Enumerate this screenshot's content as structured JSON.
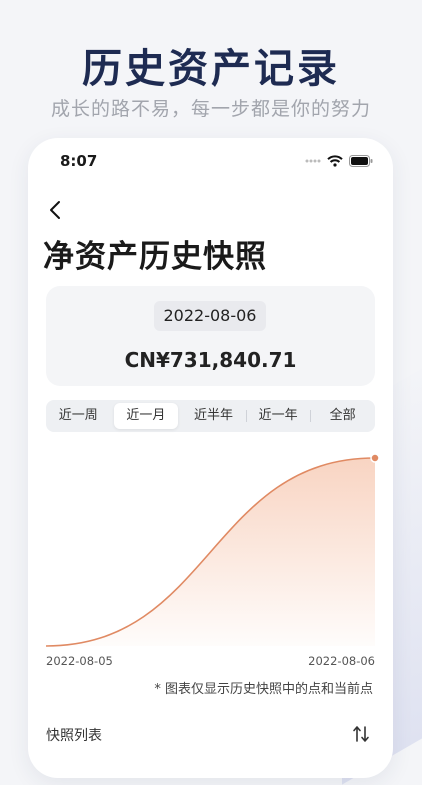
{
  "promo": {
    "headline": "历史资产记录",
    "subline": "成长的路不易，每一步都是你的努力"
  },
  "status_bar": {
    "time": "8:07",
    "icons": [
      "signal-dots-icon",
      "wifi-icon",
      "battery-icon"
    ]
  },
  "nav": {
    "back_icon": "chevron-left-icon"
  },
  "page": {
    "title": "净资产历史快照"
  },
  "snapshot": {
    "date": "2022-08-06",
    "value": "CN¥731,840.71"
  },
  "range_tabs": {
    "items": [
      "近一周",
      "近一月",
      "近半年",
      "近一年",
      "全部"
    ],
    "selected": "近一月"
  },
  "chart_data": {
    "type": "area",
    "x": [
      "2022-08-05",
      "2022-08-06"
    ],
    "x_labels": [
      "2022-08-05",
      "2022-08-06"
    ],
    "series": [
      {
        "values": [
          0,
          731840.71
        ]
      }
    ],
    "line_color": "#e08a63",
    "fill_color": "#f6c6ae",
    "note": "* 图表仅显示历史快照中的点和当前点"
  },
  "list": {
    "title": "快照列表",
    "sort_icon": "sort-arrows-icon"
  }
}
